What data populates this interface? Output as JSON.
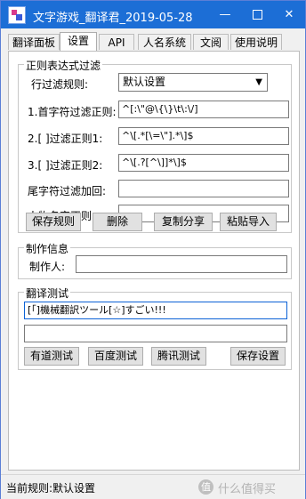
{
  "window": {
    "title": "文字游戏_翻译君_2019-05-28",
    "minimize": "—",
    "close": "✕"
  },
  "tabs": [
    {
      "label": "翻译面板"
    },
    {
      "label": "设置"
    },
    {
      "label": "API"
    },
    {
      "label": "人名系统"
    },
    {
      "label": "文阅"
    },
    {
      "label": "使用说明"
    }
  ],
  "regex": {
    "title": "正则表达式过滤",
    "line_filter_label": "行过滤规则:",
    "line_filter_value": "默认设置",
    "rule1_label": "1.首字符过滤正则:",
    "rule1_value": "^[:\\\"@\\{\\}\\t\\:\\/]",
    "rule2_label": "2.[ ]过滤正则1:",
    "rule2_value": "^\\[.*[\\=\\\"].*\\]$",
    "rule3_label": "3.[ ]过滤正则2:",
    "rule3_value": "^\\[.?[^\\]]*\\]$",
    "tail_label": "尾字符过滤加回:",
    "tail_value": "",
    "name_label": "人物名字正则:",
    "name_value": "",
    "save_btn": "保存规则",
    "delete_btn": "删除",
    "copy_btn": "复制分享",
    "paste_btn": "粘贴导入"
  },
  "credits": {
    "title": "制作信息",
    "author_label": "制作人:",
    "author_value": ""
  },
  "test": {
    "title": "翻译测试",
    "input_value": "[「]機械翻訳ツール[☆]すごい!!!",
    "output_value": "",
    "youdao_btn": "有道测试",
    "baidu_btn": "百度测试",
    "tencent_btn": "腾讯测试",
    "save_btn": "保存设置"
  },
  "status": {
    "text": "当前规则:默认设置"
  },
  "watermark": {
    "icon": "值",
    "text": "什么值得买"
  }
}
